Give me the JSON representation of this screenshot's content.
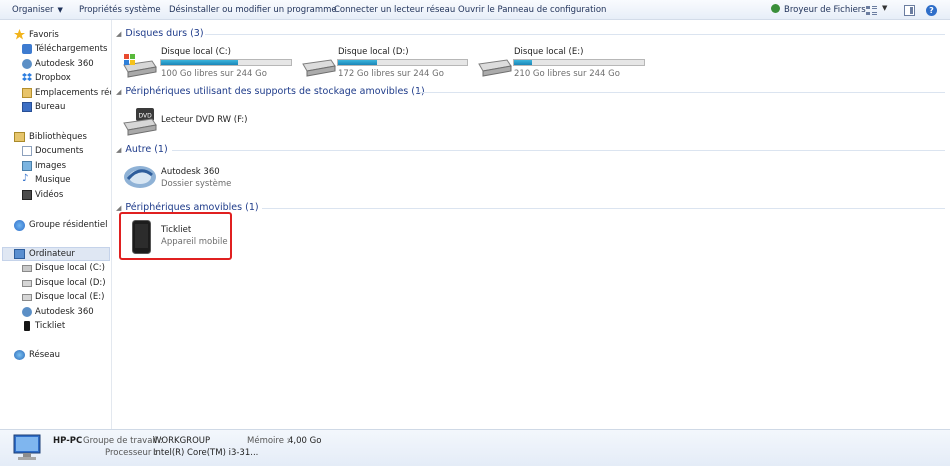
{
  "toolbar": {
    "organize": "Organiser",
    "system_properties": "Propriétés système",
    "uninstall": "Désinstaller ou modifier un programme",
    "map_drive": "Connecter un lecteur réseau",
    "control_panel": "Ouvrir le Panneau de configuration",
    "shredder": "Broyeur de Fichiers"
  },
  "nav": {
    "favorites": "Favoris",
    "downloads": "Téléchargements",
    "autodesk": "Autodesk 360",
    "dropbox": "Dropbox",
    "recent": "Emplacements récents",
    "desktop": "Bureau",
    "libraries": "Bibliothèques",
    "documents": "Documents",
    "images": "Images",
    "music": "Musique",
    "videos": "Vidéos",
    "homegroup": "Groupe résidentiel",
    "computer": "Ordinateur",
    "disk_c": "Disque local (C:)",
    "disk_d": "Disque local (D:)",
    "disk_e": "Disque local (E:)",
    "autodesk2": "Autodesk 360",
    "tickliet": "Tickliet",
    "network": "Réseau"
  },
  "groups": {
    "hard_disks": "Disques durs (3)",
    "removable_storage": "Périphériques utilisant des supports de stockage amovibles (1)",
    "other": "Autre (1)",
    "removable_devices": "Périphériques amovibles (1)"
  },
  "drives": [
    {
      "name": "Disque local (C:)",
      "free": "100 Go libres sur 244 Go",
      "used_fraction": 0.59
    },
    {
      "name": "Disque local (D:)",
      "free": "172 Go libres sur 244 Go",
      "used_fraction": 0.3
    },
    {
      "name": "Disque local (E:)",
      "free": "210 Go libres sur 244 Go",
      "used_fraction": 0.14
    }
  ],
  "dvd": {
    "name": "Lecteur DVD RW (F:)"
  },
  "autodesk_item": {
    "name": "Autodesk 360",
    "sub": "Dossier système"
  },
  "device": {
    "name": "Tickliet",
    "sub": "Appareil mobile"
  },
  "details": {
    "pc_name": "HP-PC",
    "workgroup_label": "Groupe de travail :",
    "workgroup": "WORKGROUP",
    "memory_label": "Mémoire :",
    "memory": "4,00 Go",
    "processor_label": "Processeur :",
    "processor": "Intel(R) Core(TM) i3-31..."
  },
  "colors": {
    "accent": "#1e3b8a",
    "bar_fill": "#1a86b8",
    "highlight": "#e02020"
  }
}
